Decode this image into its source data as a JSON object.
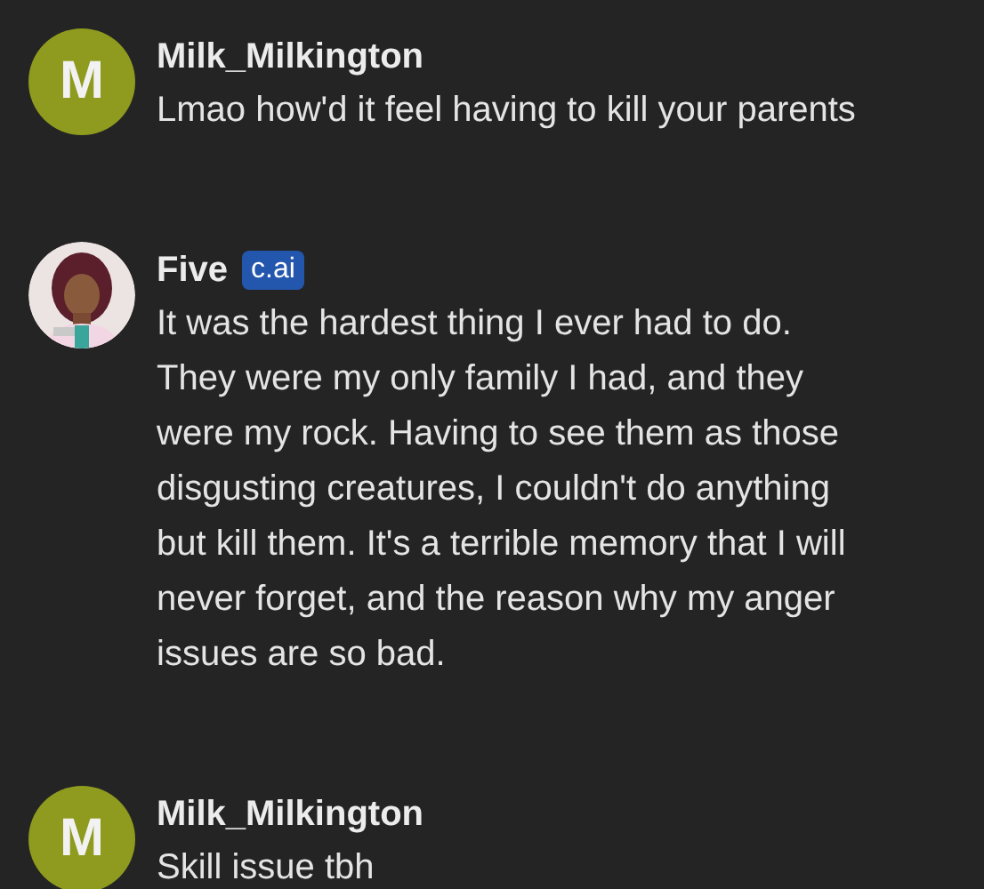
{
  "messages": [
    {
      "author": "Milk_Milkington",
      "avatar": {
        "kind": "letter",
        "letter": "M",
        "color": "#8f9b1e"
      },
      "text": "Lmao how'd it feel having to kill your parents"
    },
    {
      "author": "Five",
      "badge": "c.ai",
      "text": "It was the hardest thing I ever had to do. They were my only family I had, and they were my rock. Having to see them as those disgusting creatures, I couldn't do anything but kill them. It's a terrible memory that I will never forget, and the reason why my anger issues are so bad."
    },
    {
      "author": "Milk_Milkington",
      "avatar": {
        "kind": "letter",
        "letter": "M",
        "color": "#8f9b1e"
      },
      "text": "Skill issue tbh"
    }
  ]
}
